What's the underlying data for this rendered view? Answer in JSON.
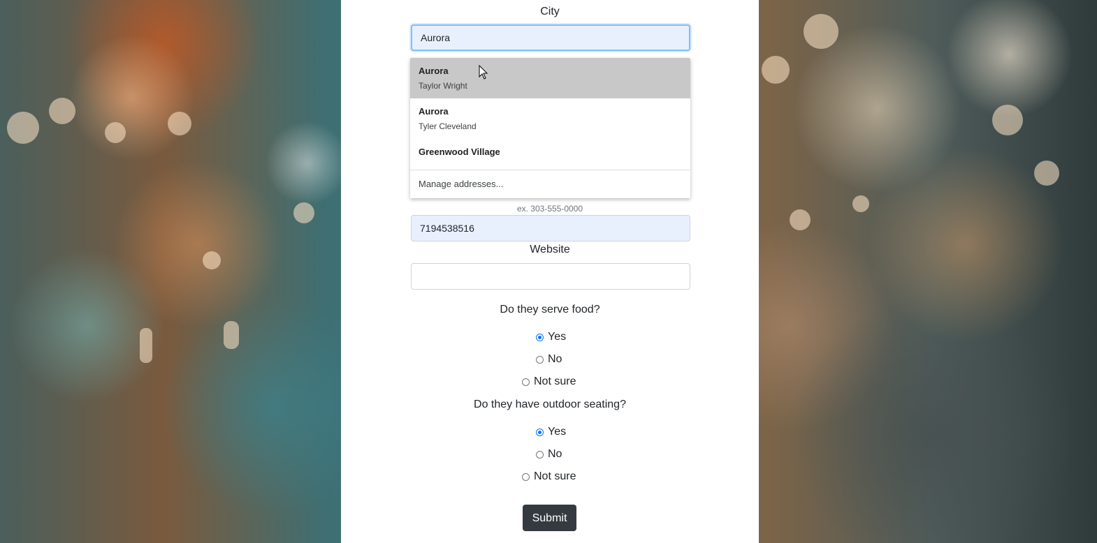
{
  "city": {
    "label": "City",
    "value": "Aurora"
  },
  "autocomplete": {
    "items": [
      {
        "title": "Aurora",
        "subtitle": "Taylor Wright"
      },
      {
        "title": "Aurora",
        "subtitle": "Tyler Cleveland"
      },
      {
        "title": "Greenwood Village",
        "subtitle": ""
      }
    ],
    "manage_label": "Manage addresses..."
  },
  "phone": {
    "hint": "ex. 303-555-0000",
    "value": "7194538516"
  },
  "website": {
    "label": "Website",
    "value": ""
  },
  "food_question": {
    "label": "Do they serve food?",
    "options": [
      "Yes",
      "No",
      "Not sure"
    ],
    "selected": "Yes"
  },
  "outdoor_question": {
    "label": "Do they have outdoor seating?",
    "options": [
      "Yes",
      "No",
      "Not sure"
    ],
    "selected": "Yes"
  },
  "submit_label": "Submit",
  "colors": {
    "submit_bg": "#343a40",
    "autofill_bg": "#e8f0fe",
    "dropdown_hover": "#c8c8c8",
    "radio_accent": "#0075ff"
  }
}
